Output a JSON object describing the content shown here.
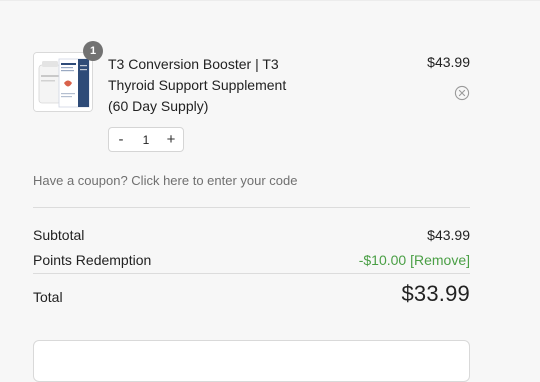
{
  "cart": {
    "item": {
      "quantity_badge": "1",
      "title_line1": "T3 Conversion Booster | T3",
      "title_line2": "Thyroid Support Supplement",
      "title_line3": "(60 Day Supply)",
      "price": "$43.99",
      "quantity_value": "1",
      "decrement_label": "-",
      "increment_label": "+"
    },
    "coupon_prompt": "Have a coupon? Click here to enter your code",
    "summary": {
      "subtotal_label": "Subtotal",
      "subtotal_value": "$43.99",
      "points_label": "Points Redemption",
      "points_value": "-$10.00",
      "points_remove_label": "[Remove]",
      "total_label": "Total",
      "total_value": "$33.99"
    }
  },
  "icons": {
    "remove_item": "close-circle-icon",
    "thumbnail": "supplement-box-image"
  },
  "colors": {
    "discount": "#4a9f45",
    "badge": "#727272"
  }
}
